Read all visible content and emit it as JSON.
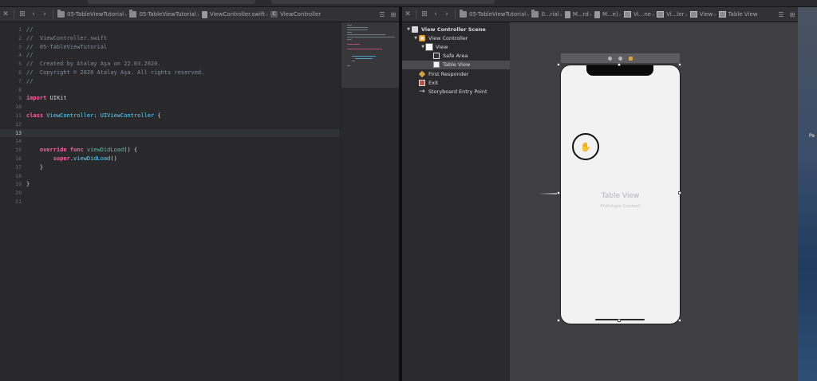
{
  "editor_jumpbar": {
    "crumbs": [
      {
        "label": "05-TableViewTutorial",
        "icon": "folder-icon"
      },
      {
        "label": "05-TableViewTutorial",
        "icon": "folder-icon"
      },
      {
        "label": "ViewController.swift",
        "icon": "swift-file-icon"
      },
      {
        "label": "ViewController",
        "icon": "class-c-icon",
        "badge": "C"
      }
    ]
  },
  "code": {
    "active_line": 13,
    "lines": [
      {
        "n": "1",
        "tokens": [
          {
            "t": "//",
            "c": "cm"
          }
        ]
      },
      {
        "n": "2",
        "tokens": [
          {
            "t": "//  ViewController.swift",
            "c": "cm"
          }
        ]
      },
      {
        "n": "3",
        "tokens": [
          {
            "t": "//  05-TableViewTutorial",
            "c": "cm"
          }
        ]
      },
      {
        "n": "4",
        "tokens": [
          {
            "t": "//",
            "c": "cm"
          }
        ]
      },
      {
        "n": "5",
        "tokens": [
          {
            "t": "//  Created by Atalay Aşa on 22.03.2020.",
            "c": "cm"
          }
        ]
      },
      {
        "n": "6",
        "tokens": [
          {
            "t": "//  Copyright © 2020 Atalay Aşa. All rights reserved.",
            "c": "cm"
          }
        ]
      },
      {
        "n": "7",
        "tokens": [
          {
            "t": "//",
            "c": "cm"
          }
        ]
      },
      {
        "n": "8",
        "tokens": []
      },
      {
        "n": "9",
        "tokens": [
          {
            "t": "import",
            "c": "kw"
          },
          {
            "t": " UIKit",
            "c": "pl"
          }
        ]
      },
      {
        "n": "10",
        "tokens": []
      },
      {
        "n": "11",
        "tokens": [
          {
            "t": "class",
            "c": "kw"
          },
          {
            "t": " ",
            "c": "pl"
          },
          {
            "t": "ViewController",
            "c": "ty"
          },
          {
            "t": ": ",
            "c": "pl"
          },
          {
            "t": "UIViewController",
            "c": "ty"
          },
          {
            "t": " {",
            "c": "pl"
          }
        ]
      },
      {
        "n": "12",
        "tokens": []
      },
      {
        "n": "13",
        "tokens": []
      },
      {
        "n": "14",
        "tokens": []
      },
      {
        "n": "15",
        "tokens": [
          {
            "t": "    override",
            "c": "kw"
          },
          {
            "t": " ",
            "c": "pl"
          },
          {
            "t": "func",
            "c": "kw"
          },
          {
            "t": " ",
            "c": "pl"
          },
          {
            "t": "viewDidLoad",
            "c": "fn"
          },
          {
            "t": "() {",
            "c": "pl"
          }
        ]
      },
      {
        "n": "16",
        "tokens": [
          {
            "t": "        super",
            "c": "kw"
          },
          {
            "t": ".",
            "c": "pl"
          },
          {
            "t": "viewDidLoad",
            "c": "ty"
          },
          {
            "t": "()",
            "c": "pl"
          }
        ]
      },
      {
        "n": "17",
        "tokens": [
          {
            "t": "    }",
            "c": "pl"
          }
        ]
      },
      {
        "n": "18",
        "tokens": []
      },
      {
        "n": "19",
        "tokens": [
          {
            "t": "}",
            "c": "pl"
          }
        ]
      },
      {
        "n": "20",
        "tokens": []
      },
      {
        "n": "21",
        "tokens": []
      }
    ]
  },
  "storyboard_jumpbar": {
    "crumbs": [
      {
        "label": "05-TableViewTutorial",
        "icon": "folder-icon"
      },
      {
        "label": "0...rial",
        "icon": "folder-icon"
      },
      {
        "label": "M...rd",
        "icon": "storyboard-file-icon"
      },
      {
        "label": "M...e)",
        "icon": "storyboard-file-icon"
      },
      {
        "label": "Vi...ne",
        "icon": "scene-icon"
      },
      {
        "label": "Vi...ler",
        "icon": "view-controller-icon"
      },
      {
        "label": "View",
        "icon": "view-icon"
      },
      {
        "label": "Table View",
        "icon": "table-view-icon"
      }
    ]
  },
  "outline": {
    "items": [
      {
        "label": "View Controller Scene",
        "icon": "scene",
        "indent": 0,
        "tri": "▼",
        "bold": true
      },
      {
        "label": "View Controller",
        "icon": "vc",
        "indent": 1,
        "tri": "▼"
      },
      {
        "label": "View",
        "icon": "view",
        "indent": 2,
        "tri": "▼"
      },
      {
        "label": "Safe Area",
        "icon": "safe",
        "indent": 3,
        "tri": ""
      },
      {
        "label": "Table View",
        "icon": "table",
        "indent": 3,
        "tri": "",
        "selected": true
      },
      {
        "label": "First Responder",
        "icon": "cube",
        "indent": 1,
        "tri": ""
      },
      {
        "label": "Exit",
        "icon": "exit",
        "indent": 1,
        "tri": ""
      },
      {
        "label": "Storyboard Entry Point",
        "icon": "arrow",
        "indent": 1,
        "tri": ""
      }
    ]
  },
  "canvas": {
    "table_view_title": "Table View",
    "table_view_subtitle": "Prototype Content"
  },
  "desktop_strip": {
    "texts": [
      "Pe"
    ]
  },
  "colors": {
    "editor_bg": "#29292c",
    "keyword": "#fc5fa3",
    "type": "#5dd8ff",
    "function": "#67b7a4",
    "comment": "#7f8c98",
    "canvas_bg": "#3f3f42"
  }
}
